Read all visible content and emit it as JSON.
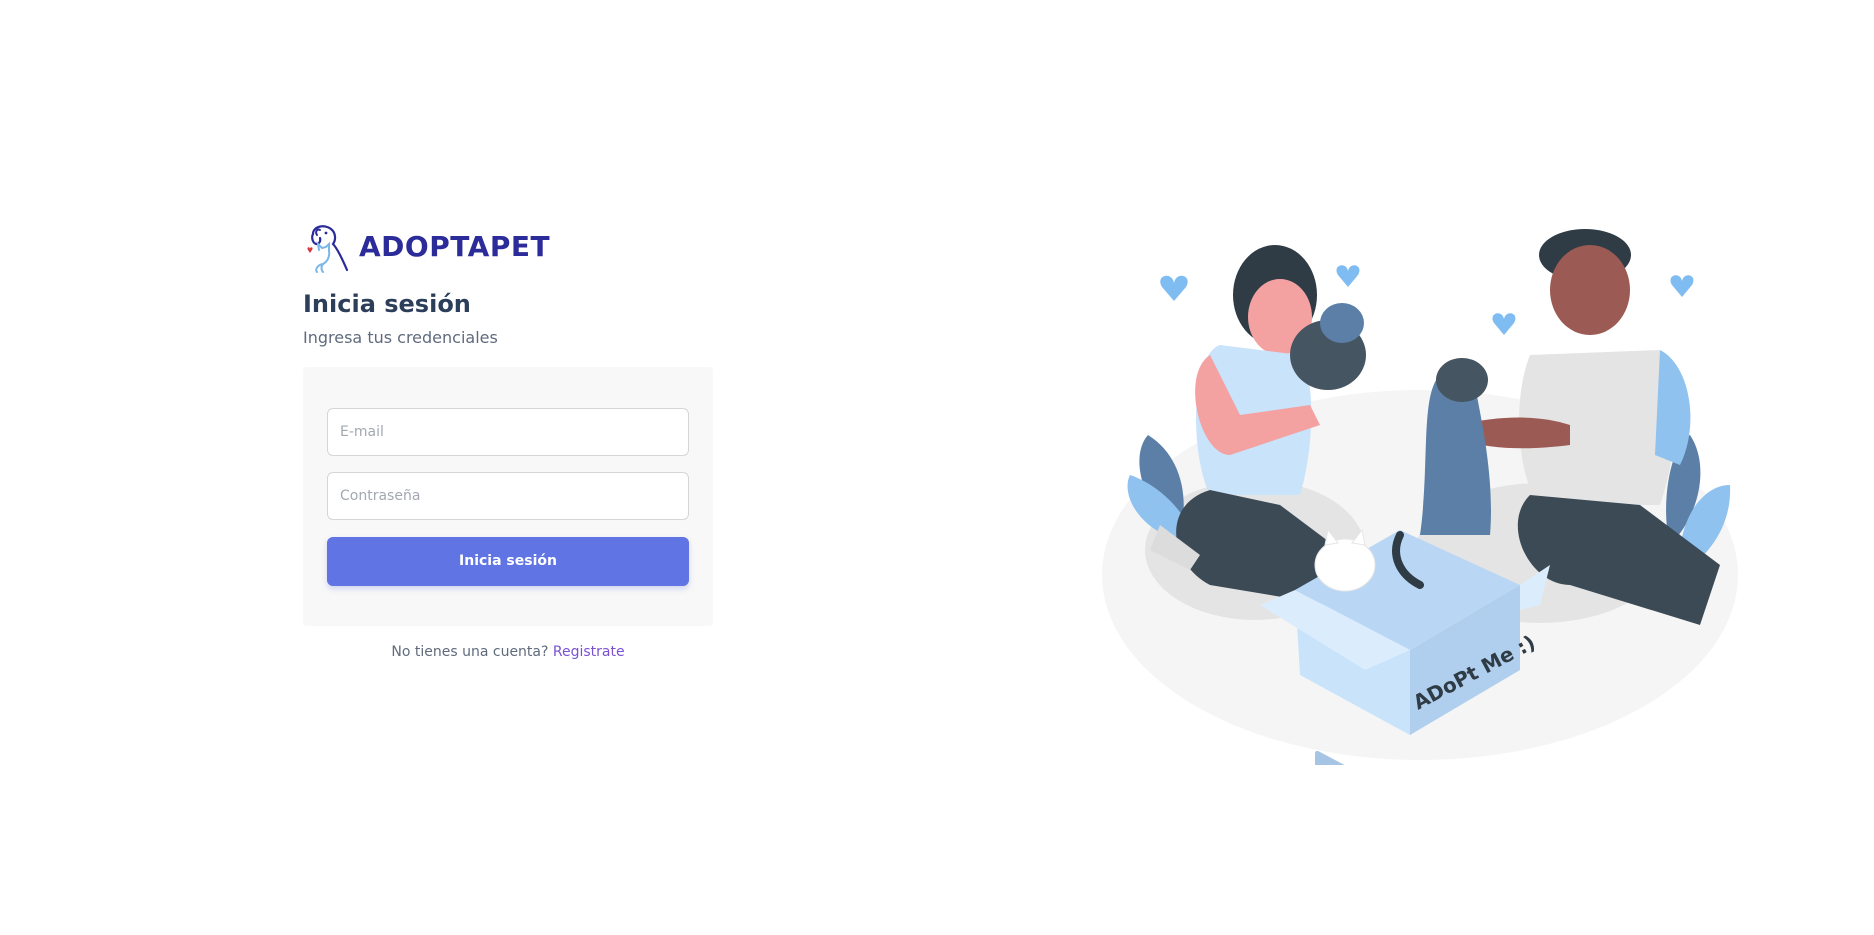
{
  "brand": {
    "name": "ADOPTAPET"
  },
  "login": {
    "title": "Inicia sesión",
    "subtitle": "Ingresa tus credenciales",
    "email_placeholder": "E-mail",
    "password_placeholder": "Contraseña",
    "submit_label": "Inicia sesión"
  },
  "register": {
    "prompt": "No tienes una cuenta?",
    "link_label": "Registrate"
  },
  "illustration": {
    "box_text": "ADoPt Me :)"
  },
  "colors": {
    "brand": "#2b2c9a",
    "primary_button": "#6174e4",
    "link": "#7a52d1",
    "card_bg": "#f8f8f8"
  }
}
